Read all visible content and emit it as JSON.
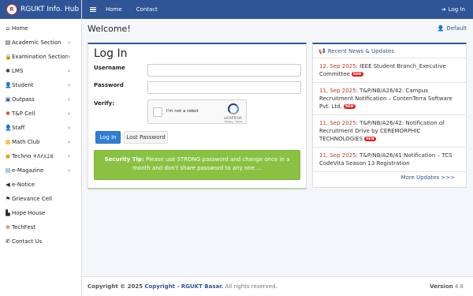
{
  "brand": {
    "logo": "R",
    "title": "RGUKT Info. Hub"
  },
  "topbar": {
    "links": [
      "Home",
      "Contact"
    ],
    "login": "Log In"
  },
  "sidebar": {
    "items": [
      {
        "icon": "home-icon",
        "glyph": "⌂",
        "label": "Home",
        "chevron": false,
        "color": "#222"
      },
      {
        "icon": "book-icon",
        "glyph": "▤",
        "label": "Academic Section",
        "chevron": true,
        "color": "#222"
      },
      {
        "icon": "lock-icon",
        "glyph": "🔒",
        "label": "Examination Section",
        "chevron": true,
        "color": "#222"
      },
      {
        "icon": "asterisk-icon",
        "glyph": "✱",
        "label": "LMS",
        "chevron": true,
        "color": "#222"
      },
      {
        "icon": "user-icon",
        "glyph": "👤",
        "label": "Student",
        "chevron": true,
        "color": "#2f7fd6"
      },
      {
        "icon": "door-icon",
        "glyph": "▣",
        "label": "Outpass",
        "chevron": true,
        "color": "#2f5597"
      },
      {
        "icon": "asterisk-icon",
        "glyph": "✱",
        "label": "T&P Cell",
        "chevron": true,
        "color": "#c0392b"
      },
      {
        "icon": "staff-icon",
        "glyph": "👤",
        "label": "Staff",
        "chevron": true,
        "color": "#27ae60"
      },
      {
        "icon": "club-icon",
        "glyph": "▦",
        "label": "Math Club",
        "chevron": true,
        "color": "#e0a800"
      },
      {
        "icon": "techno-icon",
        "glyph": "◼",
        "label": "Techno 𑀓𑀕𑀟𑀢𑀦𑀫",
        "chevron": true,
        "color": "#e0a800"
      },
      {
        "icon": "magazine-icon",
        "glyph": "▤",
        "label": "e-Magazine",
        "chevron": true,
        "color": "#1a7fc1"
      },
      {
        "icon": "megaphone-icon",
        "glyph": "◀",
        "label": "e-Notice",
        "chevron": false,
        "color": "#222"
      },
      {
        "icon": "flag-icon",
        "glyph": "⚑",
        "label": "Grievance Cell",
        "chevron": false,
        "color": "#222"
      },
      {
        "icon": "building-icon",
        "glyph": "▙",
        "label": "Hope House",
        "chevron": false,
        "color": "#222"
      },
      {
        "icon": "globe-icon",
        "glyph": "⊕",
        "label": "TechFest",
        "chevron": false,
        "color": "#c0392b"
      },
      {
        "icon": "phone-icon",
        "glyph": "✆",
        "label": "Contact Us",
        "chevron": false,
        "color": "#222"
      }
    ]
  },
  "main": {
    "welcome": "Welcome!",
    "default_link": "Default"
  },
  "login": {
    "title": "Log In",
    "username_label": "Username",
    "password_label": "Password",
    "verify_label": "Verify:",
    "username_value": "",
    "password_value": "",
    "captcha_text": "I'm not a robot",
    "captcha_brand": "reCAPTCHA",
    "captcha_terms": "Privacy - Terms",
    "login_button": "Log In",
    "lost_password_button": "Lost Password",
    "tip_title": "Security Tip:",
    "tip_text": "Please use STRONG password and change once in a month and don't share password to any one ..."
  },
  "news": {
    "title": "Recent News & Updates",
    "new_label": "NEW",
    "more": "More Updates >>>",
    "items": [
      {
        "date": "12, Sep 2025",
        "text": ": IEEE Student Branch_Executive Committee",
        "new": true
      },
      {
        "date": "11, Sep 2025",
        "text": ": T&P/NB/A26/42: Campus Recruitment Notification – ContenTerra Software Pvt. Ltd.",
        "new": true
      },
      {
        "date": "11, Sep 2025",
        "text": ": T&P/NB/A26/42: Notification of Recruitment Drive by CEREMORPHIC TECHNOLOGIES",
        "new": true
      },
      {
        "date": "11, Sep 2025",
        "text": ": T&P/NB/A26/41:Notification – TCS CodeVita Season 13 Registration",
        "new": false
      }
    ]
  },
  "footer": {
    "prefix": "Copyright © 2025",
    "link": "Copyright - RGUKT Basar.",
    "suffix": "All rights reserved.",
    "version_label": "Version",
    "version": "4.8"
  }
}
